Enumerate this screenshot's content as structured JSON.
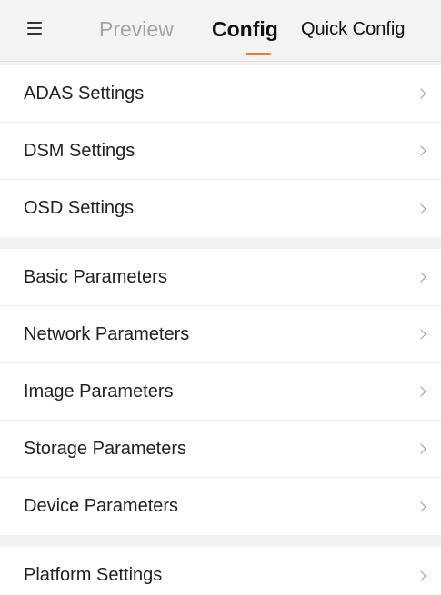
{
  "header": {
    "tabs": {
      "preview": "Preview",
      "config": "Config",
      "quick_config": "Quick Config"
    },
    "active_tab": "Config",
    "accent_color": "#f07b2e"
  },
  "groups": {
    "0": {
      "items": [
        "ADAS Settings",
        "DSM Settings",
        "OSD Settings"
      ]
    },
    "1": {
      "items": [
        "Basic Parameters",
        "Network Parameters",
        "Image Parameters",
        "Storage Parameters",
        "Device Parameters"
      ]
    },
    "2": {
      "items": [
        "Platform Settings"
      ]
    }
  },
  "icons": {
    "menu": "hamburger-menu-icon",
    "row_arrow": "chevron-right-icon"
  }
}
